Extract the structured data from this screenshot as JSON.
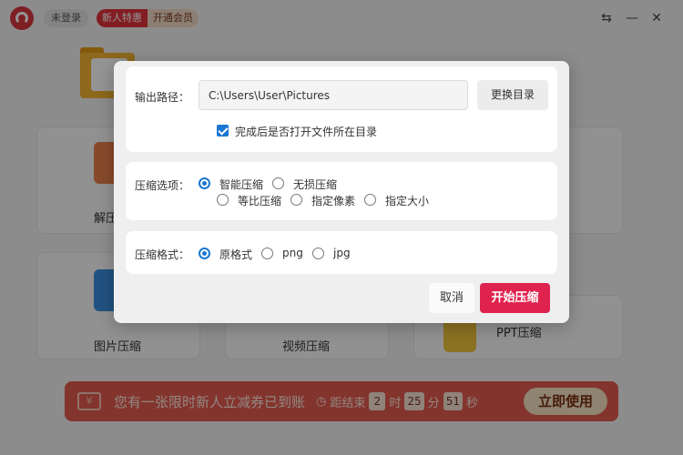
{
  "titlebar": {
    "login_label": "未登录",
    "promo_new": "新人特惠",
    "promo_vip": "开通会员",
    "settings_glyph": "⇆",
    "minimize_glyph": "—",
    "close_glyph": "✕"
  },
  "cards": {
    "decompress_label_partial": "解压",
    "image_label": "图片压缩",
    "video_label": "视频压缩",
    "ppt_label": "PPT压缩"
  },
  "banner": {
    "ticket_symbol": "¥",
    "message": "您有一张限时新人立减券已到账",
    "countdown_prefix": "距结束",
    "hours": "2",
    "hours_unit": "时",
    "minutes": "25",
    "minutes_unit": "分",
    "seconds": "51",
    "seconds_unit": "秒",
    "use_label": "立即使用"
  },
  "dialog": {
    "output": {
      "label": "输出路径：",
      "path_value": "C:\\Users\\User\\Pictures",
      "change_label": "更换目录",
      "open_after_label": "完成后是否打开文件所在目录",
      "open_after_checked": true
    },
    "compress_options": {
      "label": "压缩选项：",
      "options": [
        "智能压缩",
        "无损压缩",
        "等比压缩",
        "指定像素",
        "指定大小"
      ],
      "selected": "智能压缩"
    },
    "compress_format": {
      "label": "压缩格式：",
      "options": [
        "原格式",
        "png",
        "jpg"
      ],
      "selected": "原格式"
    },
    "cancel_label": "取消",
    "start_label": "开始压缩"
  },
  "colors": {
    "accent_blue": "#1976d2",
    "start_button": "#e0234e",
    "brand_red": "#d9363e"
  }
}
